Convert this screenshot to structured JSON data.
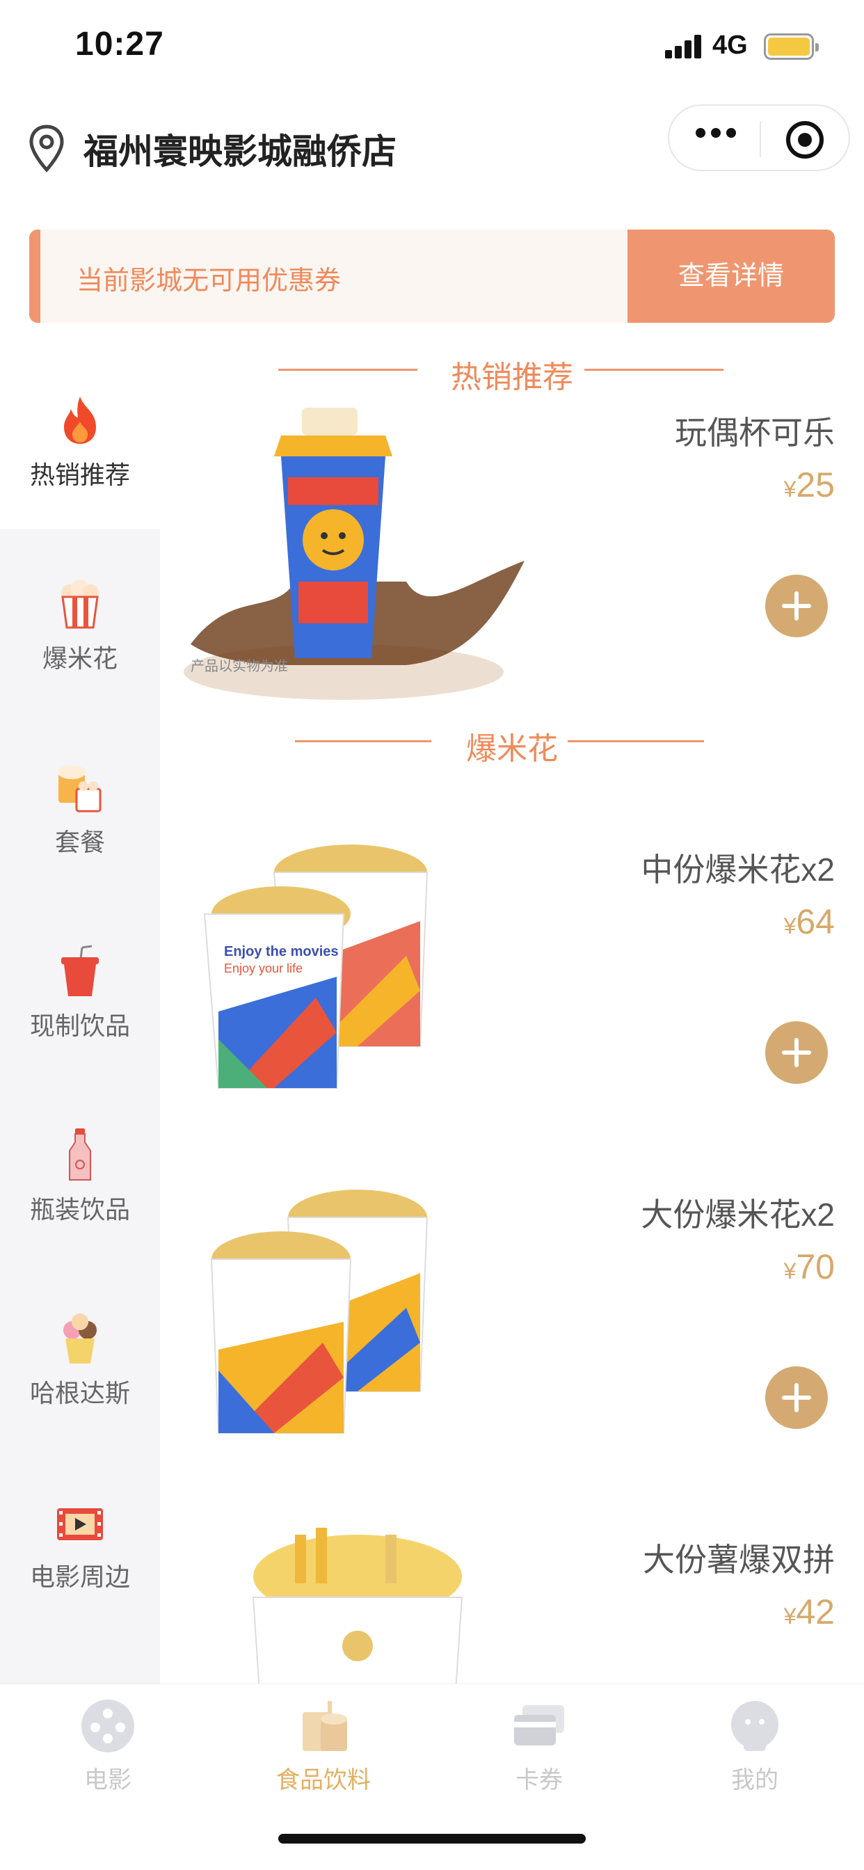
{
  "status_bar": {
    "time": "10:27",
    "network": "4G"
  },
  "header": {
    "cinema_name": "福州寰映影城融侨店"
  },
  "coupon": {
    "text": "当前影城无可用优惠券",
    "button": "查看详情"
  },
  "sidebar": {
    "items": [
      {
        "label": "热销推荐",
        "icon": "fire-icon",
        "active": true
      },
      {
        "label": "爆米花",
        "icon": "popcorn-icon"
      },
      {
        "label": "套餐",
        "icon": "combo-icon"
      },
      {
        "label": "现制饮品",
        "icon": "drink-cup-icon"
      },
      {
        "label": "瓶装饮品",
        "icon": "bottle-icon"
      },
      {
        "label": "哈根达斯",
        "icon": "ice-cream-icon"
      },
      {
        "label": "电影周边",
        "icon": "film-icon"
      }
    ]
  },
  "sections": [
    {
      "title": "热销推荐",
      "products": [
        {
          "name": "玩偶杯可乐",
          "currency": "¥",
          "price": "25",
          "image": "doll-cup-cola-image",
          "image_caption": "产品以实物为准"
        }
      ]
    },
    {
      "title": "爆米花",
      "products": [
        {
          "name": "中份爆米花x2",
          "currency": "¥",
          "price": "64",
          "image": "medium-popcorn-image",
          "box_text_1": "Enjoy the movies",
          "box_text_2": "Enjoy your life"
        },
        {
          "name": "大份爆米花x2",
          "currency": "¥",
          "price": "70",
          "image": "large-popcorn-image"
        },
        {
          "name": "大份薯爆双拼",
          "currency": "¥",
          "price": "42",
          "image": "fries-popcorn-image"
        }
      ]
    }
  ],
  "tabbar": {
    "items": [
      {
        "label": "电影",
        "icon": "film-reel-icon",
        "active": false
      },
      {
        "label": "食品饮料",
        "icon": "snacks-icon",
        "active": true
      },
      {
        "label": "卡券",
        "icon": "card-icon",
        "active": false
      },
      {
        "label": "我的",
        "icon": "profile-icon",
        "active": false
      }
    ]
  },
  "colors": {
    "accent": "#ef9670",
    "price": "#d7a86b",
    "add_button": "#d4aa72",
    "active_tab": "#e2b060"
  }
}
